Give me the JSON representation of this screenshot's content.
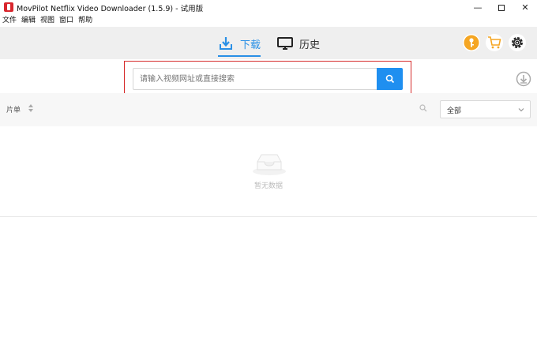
{
  "window": {
    "title": "MovPilot Netflix Video Downloader (1.5.9) - 试用版",
    "controls": {
      "minimize": "—",
      "maximize": "□",
      "close": "✕"
    }
  },
  "menu": {
    "items": [
      "文件",
      "编辑",
      "视图",
      "窗口",
      "帮助"
    ]
  },
  "tabs": [
    {
      "label": "下载",
      "icon": "download-icon",
      "active": true
    },
    {
      "label": "历史",
      "icon": "monitor-icon",
      "active": false
    }
  ],
  "toolbar": {
    "icons": [
      "key-icon",
      "cart-icon",
      "gear-icon"
    ],
    "accent_color": "#f5a623"
  },
  "search": {
    "placeholder": "请输入视频网址或直接搜索",
    "button_icon": "search-icon",
    "button_color": "#1f8ff0"
  },
  "list": {
    "column_label": "片单",
    "filter": {
      "selected": "全部"
    }
  },
  "empty_state": {
    "text": "暂无数据",
    "icon": "empty-inbox-icon"
  },
  "colors": {
    "active_tab": "#2a90e6",
    "highlight_box": "#d62b2b"
  }
}
